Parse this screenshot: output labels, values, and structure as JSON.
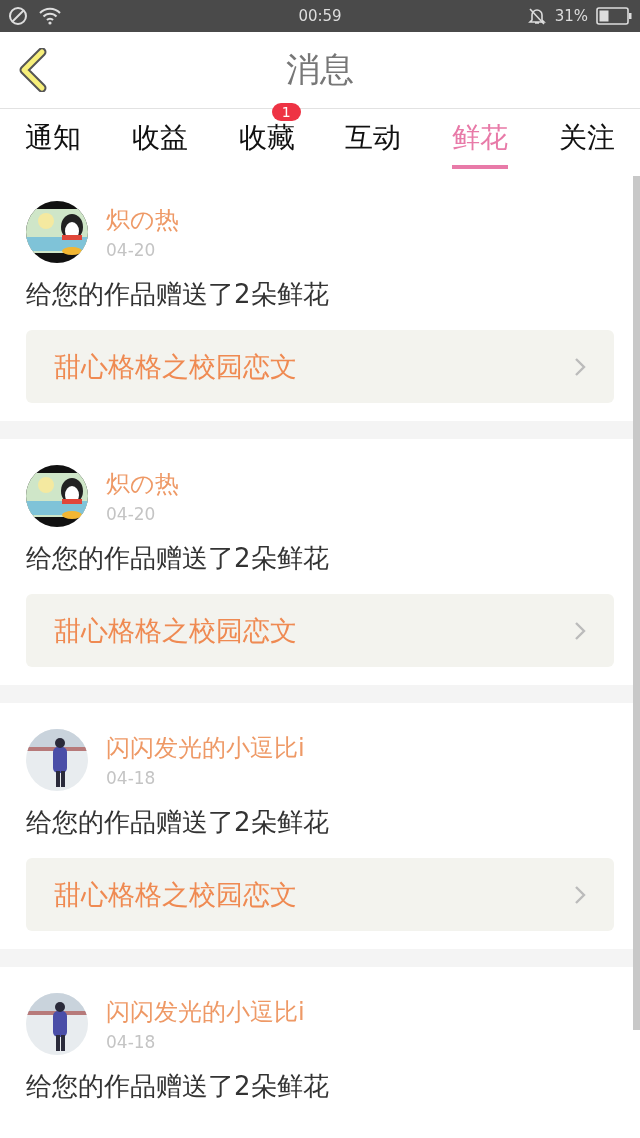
{
  "status_bar": {
    "time": "00:59",
    "battery": "31%"
  },
  "header": {
    "title": "消息"
  },
  "tabs": [
    {
      "label": "通知",
      "selected": false
    },
    {
      "label": "收益",
      "selected": false
    },
    {
      "label": "收藏",
      "selected": false,
      "badge": "1"
    },
    {
      "label": "互动",
      "selected": false
    },
    {
      "label": "鲜花",
      "selected": true
    },
    {
      "label": "关注",
      "selected": false
    }
  ],
  "messages": [
    {
      "name": "炽の热",
      "date": "04-20",
      "text": "给您的作品赠送了2朵鲜花",
      "book": "甜心格格之校园恋文"
    },
    {
      "name": "炽の热",
      "date": "04-20",
      "text": "给您的作品赠送了2朵鲜花",
      "book": "甜心格格之校园恋文"
    },
    {
      "name": "闪闪发光的小逗比i",
      "date": "04-18",
      "text": "给您的作品赠送了2朵鲜花",
      "book": "甜心格格之校园恋文"
    },
    {
      "name": "闪闪发光的小逗比i",
      "date": "04-18",
      "text": "给您的作品赠送了2朵鲜花"
    }
  ]
}
